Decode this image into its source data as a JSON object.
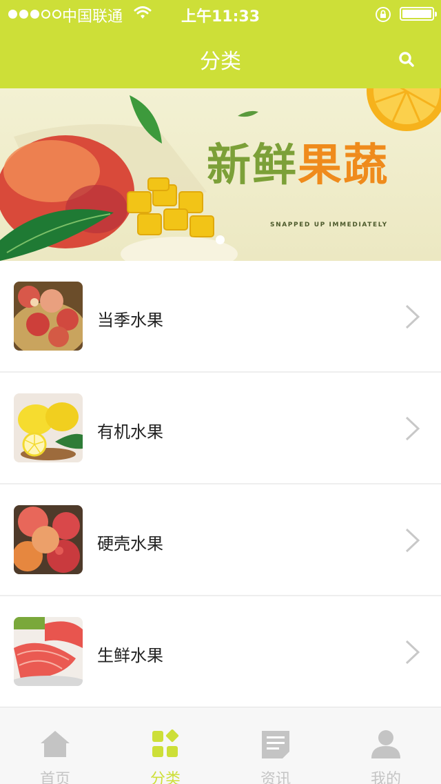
{
  "status_bar": {
    "carrier": "中国联通",
    "time": "上午11:33"
  },
  "header": {
    "title": "分类",
    "search_icon": "search-icon"
  },
  "banner": {
    "title_green": "新鲜",
    "title_orange": "果蔬",
    "subtitle": "SNAPPED UP IMMEDIATELY"
  },
  "categories": [
    {
      "label": "当季水果",
      "image": "peaches"
    },
    {
      "label": "有机水果",
      "image": "lemons"
    },
    {
      "label": "硬壳水果",
      "image": "apples"
    },
    {
      "label": "生鲜水果",
      "image": "grapefruit"
    }
  ],
  "tabs": [
    {
      "label": "首页",
      "icon": "home-icon"
    },
    {
      "label": "分类",
      "icon": "grid-icon"
    },
    {
      "label": "资讯",
      "icon": "document-icon"
    },
    {
      "label": "我的",
      "icon": "user-icon"
    }
  ],
  "colors": {
    "accent": "#cddf38",
    "tab_inactive": "#c4c4c4"
  }
}
